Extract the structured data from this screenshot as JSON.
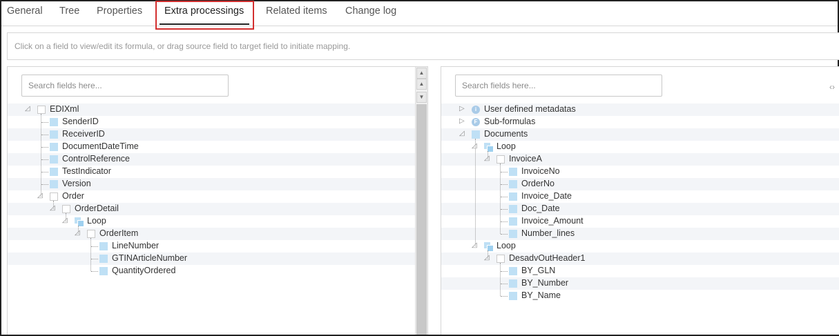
{
  "tabs": [
    {
      "label": "General"
    },
    {
      "label": "Tree"
    },
    {
      "label": "Properties"
    },
    {
      "label": "Extra processings",
      "active": true
    },
    {
      "label": "Related items"
    },
    {
      "label": "Change log"
    }
  ],
  "hint": "Click on a field to view/edit its formula, or drag source field to target field to initiate mapping.",
  "source": {
    "search_placeholder": "Search fields here...",
    "tree": [
      {
        "label": "EDIXml",
        "type": "root",
        "depth": 0,
        "expanded": true
      },
      {
        "label": "SenderID",
        "type": "leaf",
        "depth": 1
      },
      {
        "label": "ReceiverID",
        "type": "leaf",
        "depth": 1
      },
      {
        "label": "DocumentDateTime",
        "type": "leaf",
        "depth": 1
      },
      {
        "label": "ControlReference",
        "type": "leaf",
        "depth": 1
      },
      {
        "label": "TestIndicator",
        "type": "leaf",
        "depth": 1
      },
      {
        "label": "Version",
        "type": "leaf",
        "depth": 1
      },
      {
        "label": "Order",
        "type": "node",
        "depth": 1,
        "expanded": true
      },
      {
        "label": "OrderDetail",
        "type": "node",
        "depth": 2,
        "expanded": true
      },
      {
        "label": "Loop",
        "type": "loop",
        "depth": 3,
        "expanded": true
      },
      {
        "label": "OrderItem",
        "type": "node",
        "depth": 4,
        "expanded": true
      },
      {
        "label": "LineNumber",
        "type": "leaf",
        "depth": 5
      },
      {
        "label": "GTINArticleNumber",
        "type": "leaf",
        "depth": 5
      },
      {
        "label": "QuantityOrdered",
        "type": "leaf",
        "depth": 5
      }
    ]
  },
  "target": {
    "search_placeholder": "Search fields here...",
    "tree": [
      {
        "label": "User defined metadatas",
        "type": "info",
        "depth": 0,
        "expanded": false
      },
      {
        "label": "Sub-formulas",
        "type": "formula",
        "depth": 0,
        "expanded": false
      },
      {
        "label": "Documents",
        "type": "docs",
        "depth": 0,
        "expanded": true
      },
      {
        "label": "Loop",
        "type": "loop",
        "depth": 1,
        "expanded": true
      },
      {
        "label": "InvoiceA",
        "type": "node",
        "depth": 2,
        "expanded": true
      },
      {
        "label": "InvoiceNo",
        "type": "leaf",
        "depth": 3
      },
      {
        "label": "OrderNo",
        "type": "leaf",
        "depth": 3
      },
      {
        "label": "Invoice_Date",
        "type": "leaf",
        "depth": 3
      },
      {
        "label": "Doc_Date",
        "type": "leaf",
        "depth": 3
      },
      {
        "label": "Invoice_Amount",
        "type": "leaf",
        "depth": 3
      },
      {
        "label": "Number_lines",
        "type": "leaf",
        "depth": 3
      },
      {
        "label": "Loop",
        "type": "loop",
        "depth": 1,
        "expanded": true
      },
      {
        "label": "DesadvOutHeader1",
        "type": "node",
        "depth": 2,
        "expanded": true
      },
      {
        "label": "BY_GLN",
        "type": "leaf",
        "depth": 3
      },
      {
        "label": "BY_Number",
        "type": "leaf",
        "depth": 3
      },
      {
        "label": "BY_Name",
        "type": "leaf",
        "depth": 3
      }
    ]
  },
  "icons": {
    "info": "i",
    "formula": "F",
    "collapse": "‹›",
    "scroll_up": "▲",
    "scroll_down": "▼"
  },
  "colors": {
    "highlight": "#d32f2f",
    "leaf": "#bfe0f5",
    "row_alt": "#f3f5f8"
  }
}
